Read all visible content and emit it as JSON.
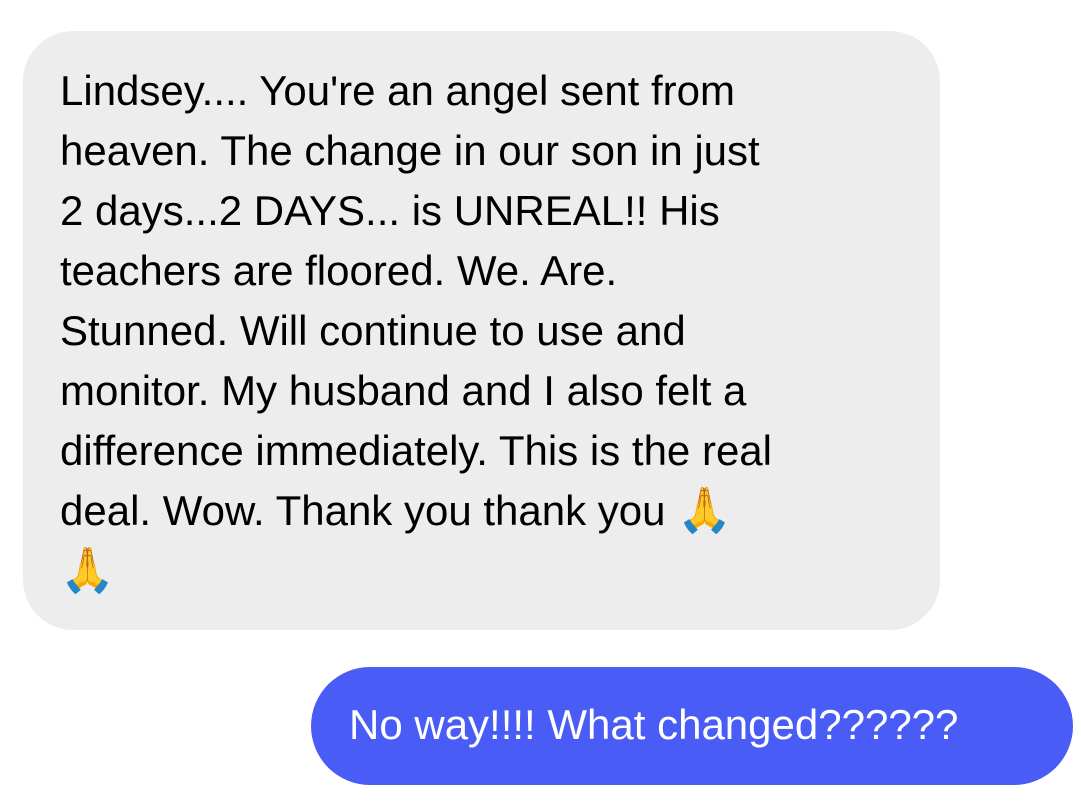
{
  "messages": {
    "incoming": {
      "text": "Lindsey.... You're an angel sent from\nheaven. The change in our son in just\n2 days...2 DAYS... is UNREAL!! His\nteachers are floored. We. Are.\nStunned. Will continue to use and\nmonitor. My husband and I also felt a\ndifference immediately. This is the real\ndeal. Wow. Thank you thank you ",
      "emoji_1": "🙏",
      "emoji_2": "🙏",
      "emoji_icon": "folded-hands-icon",
      "bubble_color": "#ededed"
    },
    "outgoing": {
      "text": "No way!!!! What changed??????",
      "bubble_color": "#4a5cf6"
    }
  }
}
